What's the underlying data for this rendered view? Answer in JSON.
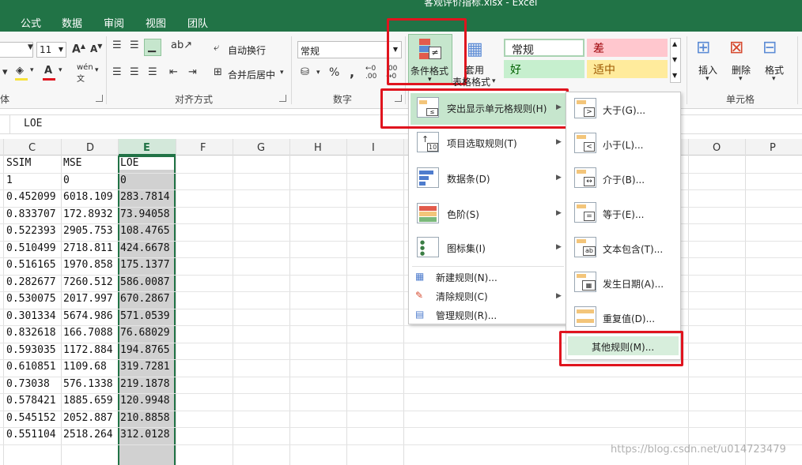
{
  "window": {
    "title": "客观评价指标.xlsx - Excel"
  },
  "tabs": [
    "公式",
    "数据",
    "审阅",
    "视图",
    "团队"
  ],
  "ribbon": {
    "font": {
      "size": "11",
      "group_label": "体"
    },
    "alignment": {
      "wrap_text": "自动换行",
      "merge_center": "合并后居中",
      "group_label": "对齐方式"
    },
    "number": {
      "format": "常规",
      "percent": "%",
      "comma": ",",
      "group_label": "数字"
    },
    "conditional_format": {
      "label": "条件格式"
    },
    "format_table": {
      "label_line1": "套用",
      "label_line2": "表格格式"
    },
    "styles": {
      "normal": "常规",
      "bad": "差",
      "good": "好",
      "neutral": "适中"
    },
    "cells": {
      "insert": "插入",
      "delete": "删除",
      "format": "格式",
      "group_label": "单元格"
    }
  },
  "formula_bar": {
    "value": "LOE"
  },
  "grid": {
    "columns": [
      "C",
      "D",
      "E",
      "F",
      "G",
      "H",
      "I",
      "O",
      "P"
    ],
    "headers": [
      "SSIM",
      "MSE",
      "LOE"
    ],
    "rows": [
      [
        "1",
        "0",
        "0"
      ],
      [
        "0.452099",
        "6018.109",
        "283.7814"
      ],
      [
        "0.833707",
        "172.8932",
        "73.94058"
      ],
      [
        "0.522393",
        "2905.753",
        "108.4765"
      ],
      [
        "0.510499",
        "2718.811",
        "424.6678"
      ],
      [
        "0.516165",
        "1970.858",
        "175.1377"
      ],
      [
        "0.282677",
        "7260.512",
        "586.0087"
      ],
      [
        "0.530075",
        "2017.997",
        "670.2867"
      ],
      [
        "0.301334",
        "5674.986",
        "571.0539"
      ],
      [
        "0.832618",
        "166.7088",
        "76.68029"
      ],
      [
        "0.593035",
        "1172.884",
        "194.8765"
      ],
      [
        "0.610851",
        "1109.68",
        "319.7281"
      ],
      [
        "0.73038",
        "576.1338",
        "219.1878"
      ],
      [
        "0.578421",
        "1885.659",
        "120.9948"
      ],
      [
        "0.545152",
        "2052.887",
        "210.8858"
      ],
      [
        "0.551104",
        "2518.264",
        "312.0128"
      ]
    ]
  },
  "menu_main": {
    "items": [
      {
        "label": "突出显示单元格规则(H)",
        "highlighted": true
      },
      {
        "label": "项目选取规则(T)"
      },
      {
        "label": "数据条(D)"
      },
      {
        "label": "色阶(S)"
      },
      {
        "label": "图标集(I)"
      },
      {
        "label": "新建规则(N)..."
      },
      {
        "label": "清除规则(C)"
      },
      {
        "label": "管理规则(R)..."
      }
    ]
  },
  "menu_sub": {
    "items": [
      {
        "label": "大于(G)..."
      },
      {
        "label": "小于(L)..."
      },
      {
        "label": "介于(B)..."
      },
      {
        "label": "等于(E)..."
      },
      {
        "label": "文本包含(T)..."
      },
      {
        "label": "发生日期(A)..."
      },
      {
        "label": "重复值(D)..."
      },
      {
        "label": "其他规则(M)...",
        "highlighted": true
      }
    ]
  },
  "watermark": "https://blog.csdn.net/u014723479",
  "colors": {
    "accent": "#217346",
    "highlight_red": "#e0141e",
    "menu_hover": "#c6e6cd"
  }
}
